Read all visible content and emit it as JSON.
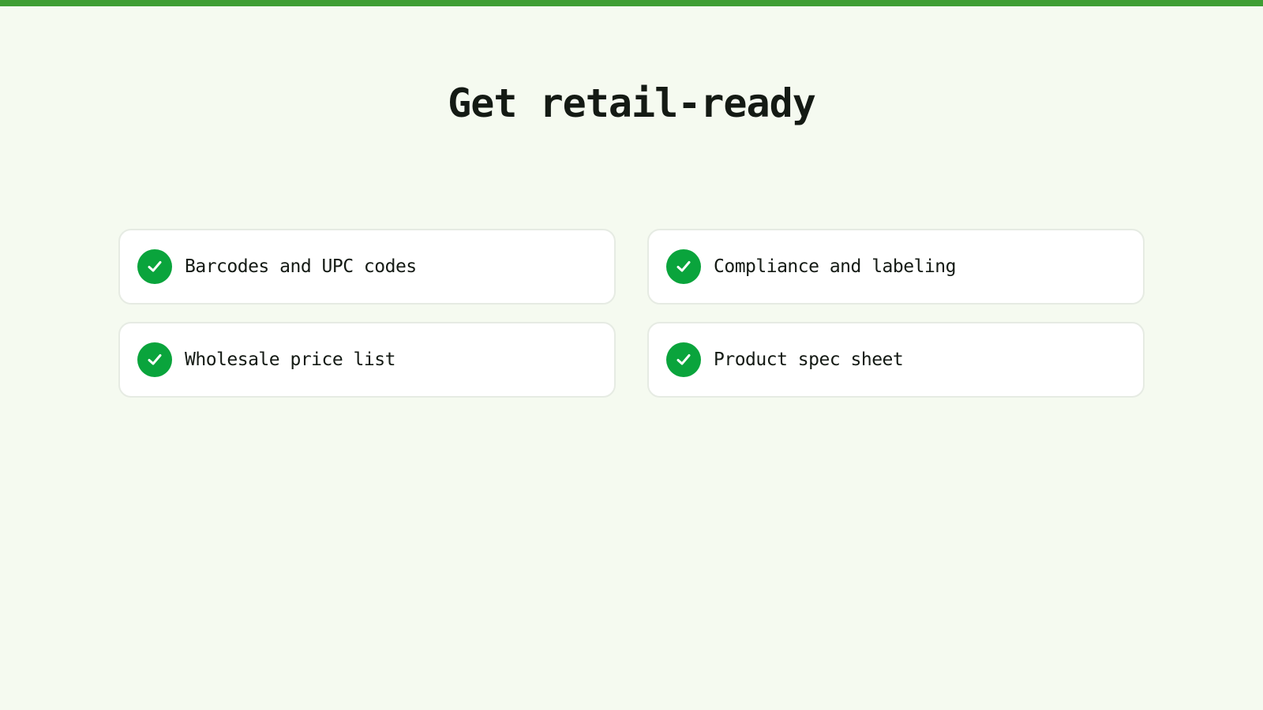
{
  "page": {
    "title": "Get retail-ready"
  },
  "checklist": {
    "items": [
      {
        "label": "Barcodes and UPC codes",
        "icon": "check-circle-icon",
        "checked": true
      },
      {
        "label": "Compliance and labeling",
        "icon": "check-circle-icon",
        "checked": true
      },
      {
        "label": "Wholesale price list",
        "icon": "check-circle-icon",
        "checked": true
      },
      {
        "label": "Product spec sheet",
        "icon": "check-circle-icon",
        "checked": true
      }
    ]
  },
  "colors": {
    "accent_bar": "#3f9e34",
    "check_green": "#0aa43c",
    "background": "#f5faf0",
    "card": "#ffffff",
    "text": "#141a14"
  }
}
